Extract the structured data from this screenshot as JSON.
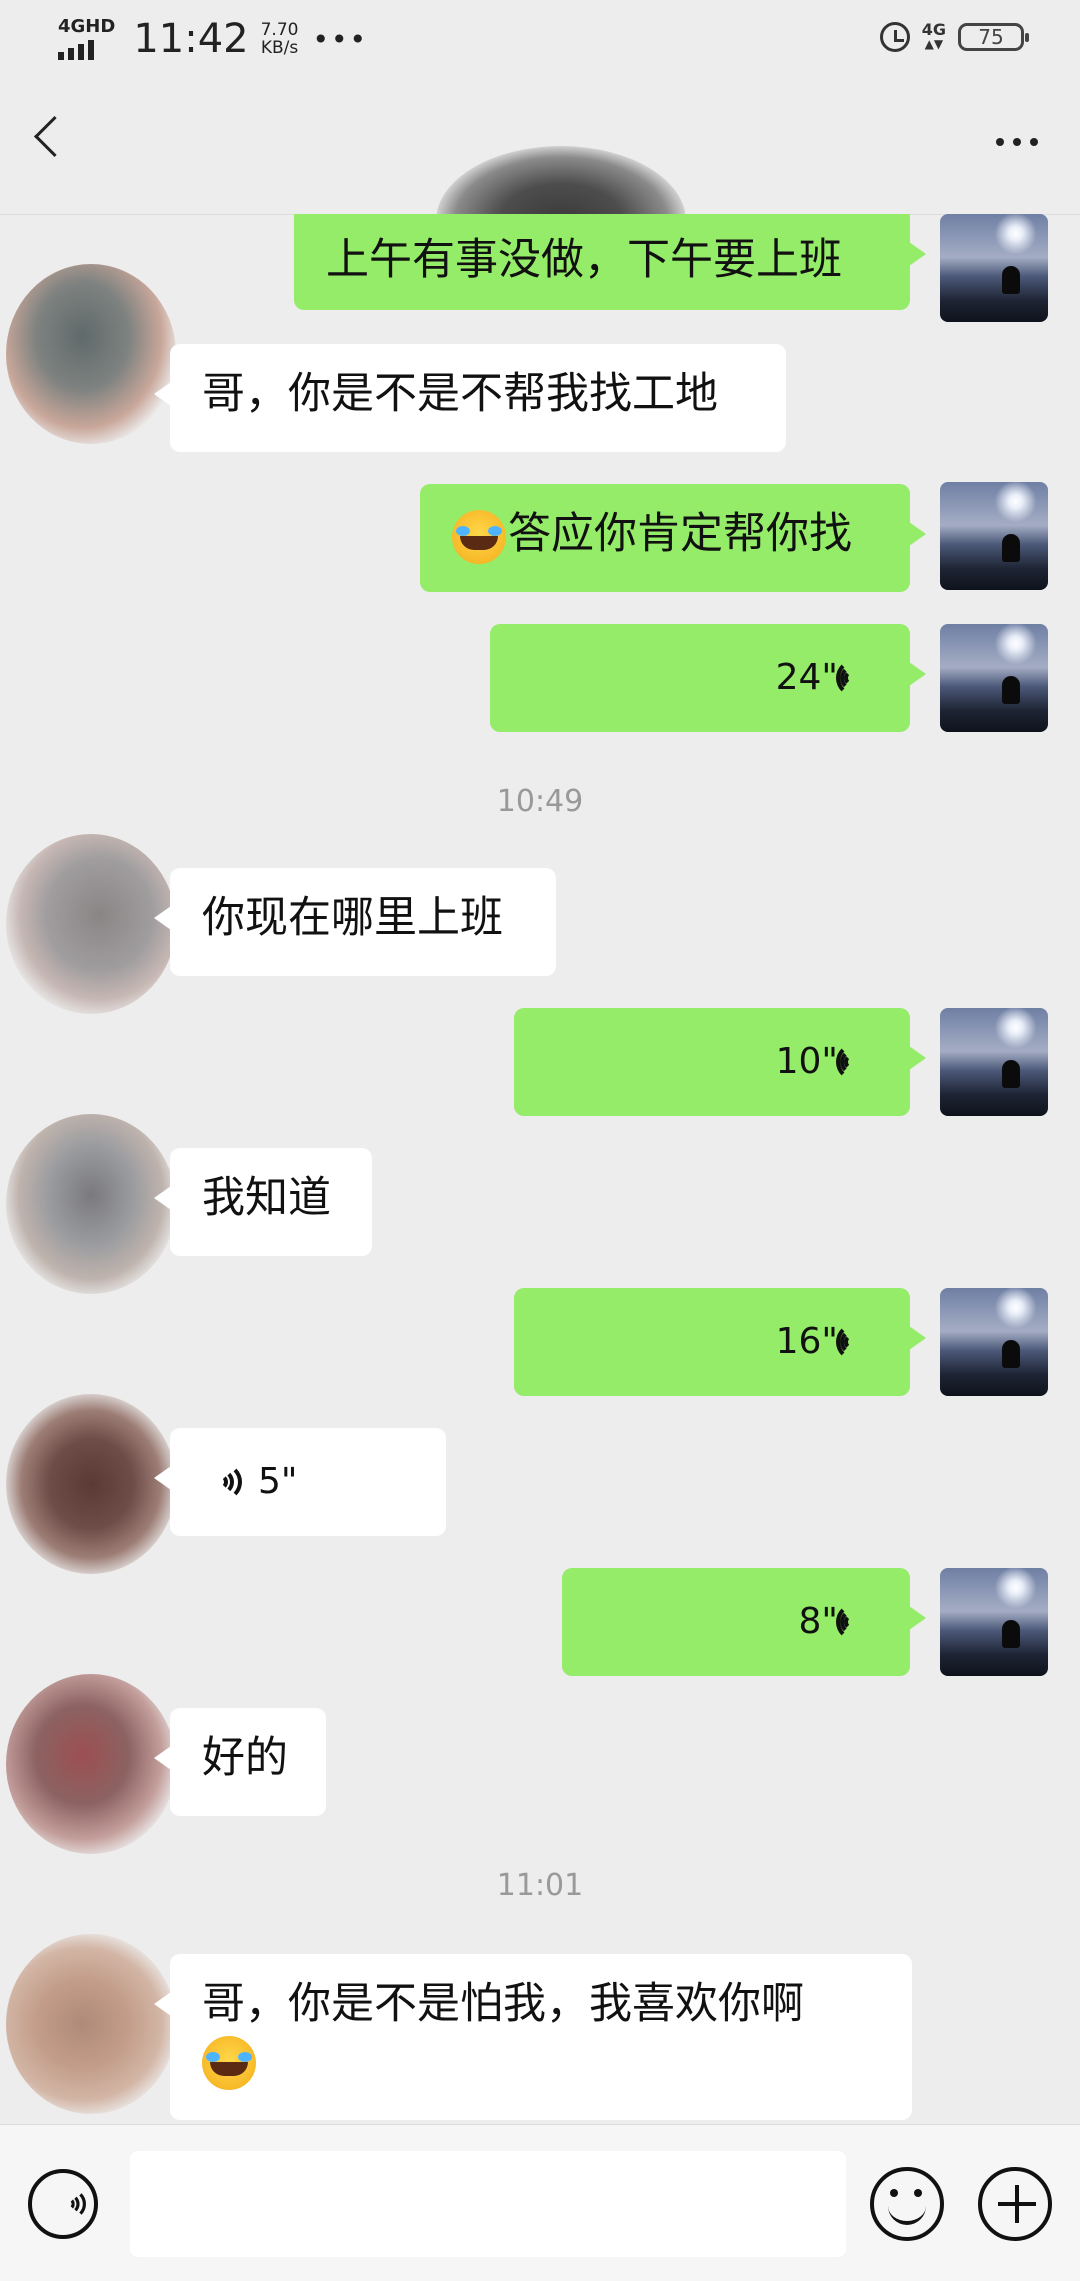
{
  "status_bar": {
    "network": "4GHD",
    "time": "11:42",
    "speed_value": "7.70",
    "speed_unit": "KB/s",
    "more": "•••",
    "right_network": "4G",
    "battery": "75"
  },
  "header": {
    "back_icon": "chevron-left-icon",
    "more_icon": "more-dots-icon"
  },
  "messages": [
    {
      "side": "me",
      "type": "text",
      "text": "上午有事没做，下午要上班"
    },
    {
      "side": "them",
      "type": "text",
      "text": "哥，你是不是不帮我找工地"
    },
    {
      "side": "me",
      "type": "text",
      "emoji": "crying-laughing-emoji",
      "text": "答应你肯定帮你找"
    },
    {
      "side": "me",
      "type": "voice",
      "duration": "24\""
    },
    {
      "type": "timestamp",
      "text": "10:49"
    },
    {
      "side": "them",
      "type": "text",
      "text": "你现在哪里上班"
    },
    {
      "side": "me",
      "type": "voice",
      "duration": "10\""
    },
    {
      "side": "them",
      "type": "text",
      "text": "我知道"
    },
    {
      "side": "me",
      "type": "voice",
      "duration": "16\""
    },
    {
      "side": "them",
      "type": "voice",
      "duration": "5\""
    },
    {
      "side": "me",
      "type": "voice",
      "duration": "8\""
    },
    {
      "side": "them",
      "type": "text",
      "text": "好的"
    },
    {
      "type": "timestamp",
      "text": "11:01"
    },
    {
      "side": "them",
      "type": "text",
      "text": "哥，你是不是怕我，我喜欢你啊",
      "emoji_after": "crying-laughing-emoji"
    }
  ],
  "input_bar": {
    "voice_icon": "voice-toggle-icon",
    "input_value": "",
    "emoji_icon": "emoji-icon",
    "plus_icon": "plus-icon"
  },
  "colors": {
    "background": "#ededed",
    "my_bubble": "#95ec69",
    "their_bubble": "#ffffff",
    "timestamp": "#999999"
  }
}
